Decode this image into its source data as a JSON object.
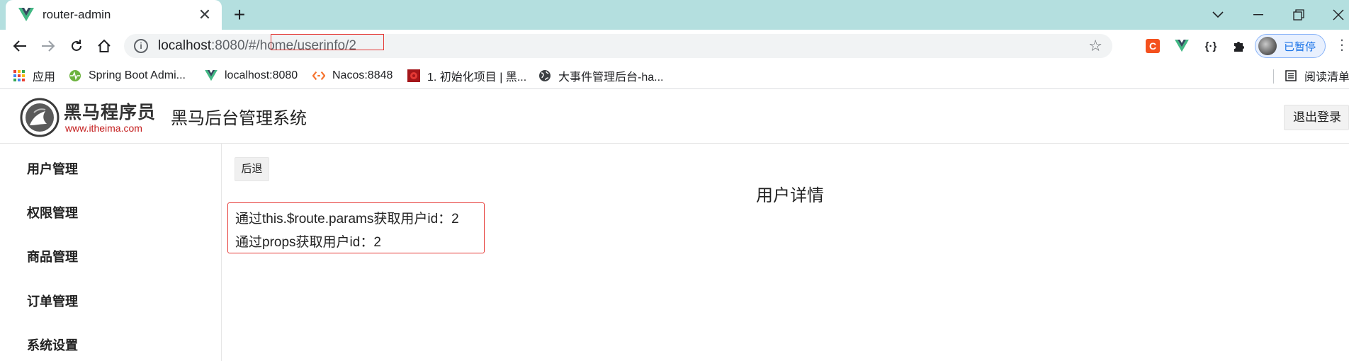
{
  "browser": {
    "tab_title": "router-admin",
    "tab_close": "✕",
    "new_tab": "+",
    "url_host": "localhost",
    "url_rest": ":8080/#/home/userinfo/2",
    "star": "☆",
    "profile_label": "已暂停",
    "menu": "⋮"
  },
  "bookmarks": [
    {
      "label": "应用",
      "icon": "apps-grid-icon"
    },
    {
      "label": "Spring Boot Admi...",
      "icon": "pulse-icon"
    },
    {
      "label": "localhost:8080",
      "icon": "vue-logo-icon"
    },
    {
      "label": "Nacos:8848",
      "icon": "nacos-icon"
    },
    {
      "label": "1. 初始化项目 | 黑...",
      "icon": "red-square-icon"
    },
    {
      "label": "大事件管理后台-ha...",
      "icon": "globe-icon"
    },
    {
      "label": "阅读清单",
      "icon": "reading-list-icon"
    }
  ],
  "app": {
    "logo_cn": "黑马程序员",
    "logo_url": "www.itheima.com",
    "title": "黑马后台管理系统",
    "logout": "退出登录",
    "sidebar": [
      "用户管理",
      "权限管理",
      "商品管理",
      "订单管理",
      "系统设置"
    ],
    "back": "后退",
    "detail_title": "用户详情",
    "line1": "通过this.$route.params获取用户id：2",
    "line2": "通过props获取用户id：2"
  },
  "colors": {
    "tabbar": "#b4dfdf",
    "highlight_border": "#e53935",
    "profile_blue": "#1a73e8"
  }
}
